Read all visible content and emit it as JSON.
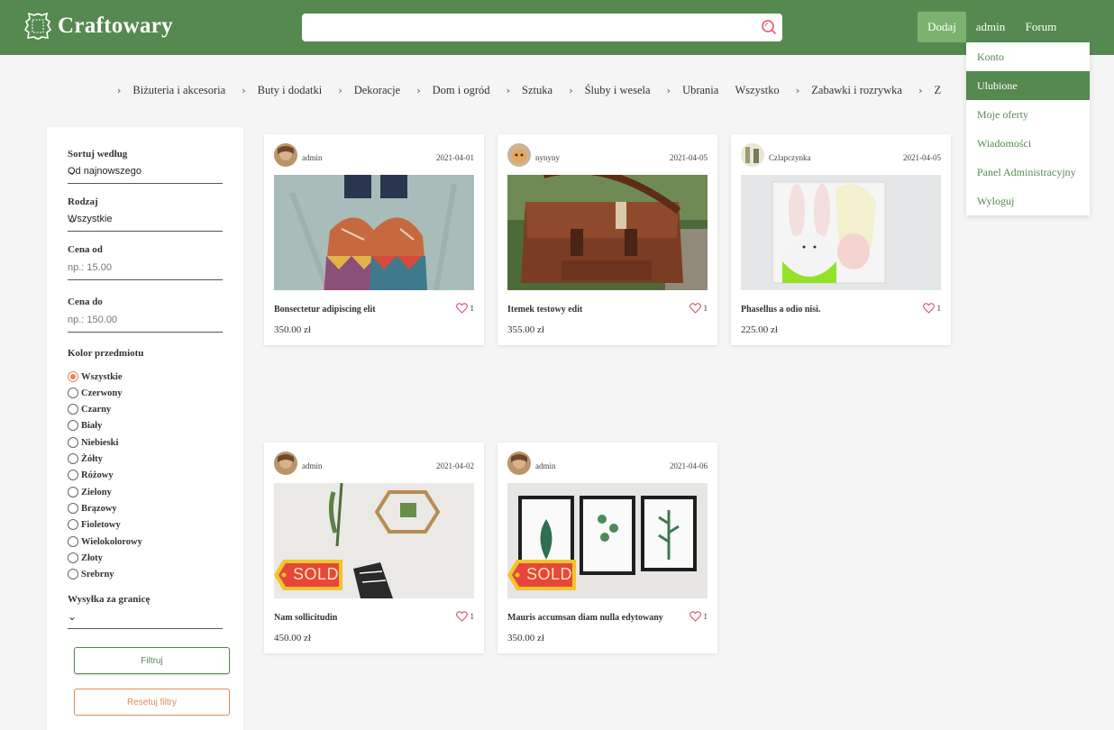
{
  "header": {
    "logo_text": "Craftowary",
    "search_value": "",
    "nav_add": "Dodaj",
    "nav_user": "admin",
    "nav_forum": "Forum"
  },
  "user_menu": [
    "Konto",
    "Ulubione",
    "Moje oferty",
    "Wiadomości",
    "Panel Administracyjny",
    "Wyloguj"
  ],
  "categories": [
    "Biżuteria i akcesoria",
    "Buty i dodatki",
    "Dekoracje",
    "Dom i ogród",
    "Sztuka",
    "Śluby i wesela",
    "Ubrania",
    "Wszystko",
    "Zabawki i rozrywka",
    "Z"
  ],
  "filters": {
    "sort_label": "Sortuj według",
    "sort_value": "Od najnowszego",
    "type_label": "Rodzaj",
    "type_value": "Wszystkie",
    "price_from_label": "Cena od",
    "price_from_placeholder": "np.: 15.00",
    "price_to_label": "Cena do",
    "price_to_placeholder": "np.: 150.00",
    "color_label": "Kolor przedmiotu",
    "colors": [
      "Wszystkie",
      "Czerwony",
      "Czarny",
      "Biały",
      "Niebieski",
      "Żółty",
      "Różowy",
      "Zielony",
      "Brązowy",
      "Fioletowy",
      "Wielokolorowy",
      "Złoty",
      "Srebrny"
    ],
    "color_selected": "Wszystkie",
    "shipping_label": "Wysyłka za granicę",
    "shipping_value": "",
    "filter_button": "Filtruj",
    "reset_button": "Resetuj filtry"
  },
  "products": [
    {
      "author": "admin",
      "date": "2021-04-01",
      "title": "Bonsectetur adipiscing elit",
      "likes": "1",
      "price": "350.00 zł",
      "sold": false
    },
    {
      "author": "nynyny",
      "date": "2021-04-05",
      "title": "Itemek testowy edit",
      "likes": "1",
      "price": "355.00 zł",
      "sold": false
    },
    {
      "author": "Czlapczynka",
      "date": "2021-04-05",
      "title": "Phasellus a odio nisi.",
      "likes": "1",
      "price": "225.00 zł",
      "sold": false
    },
    {
      "author": "admin",
      "date": "2021-04-02",
      "title": "Nam sollicitudin",
      "likes": "1",
      "price": "450.00 zł",
      "sold": true,
      "badge": "SOLD"
    },
    {
      "author": "admin",
      "date": "2021-04-06",
      "title": "Mauris accumsan diam nulla edytowany",
      "likes": "1",
      "price": "350.00 zł",
      "sold": true,
      "badge": "SOLD"
    }
  ],
  "colors": {
    "brand": "#55894f",
    "brand_light": "#7cb26f",
    "accent": "#e08a54",
    "heart": "#e0506a"
  },
  "icons": [
    "logo-icon",
    "search-icon",
    "chevron-right-icon",
    "chevron-down-icon",
    "heart-icon"
  ]
}
